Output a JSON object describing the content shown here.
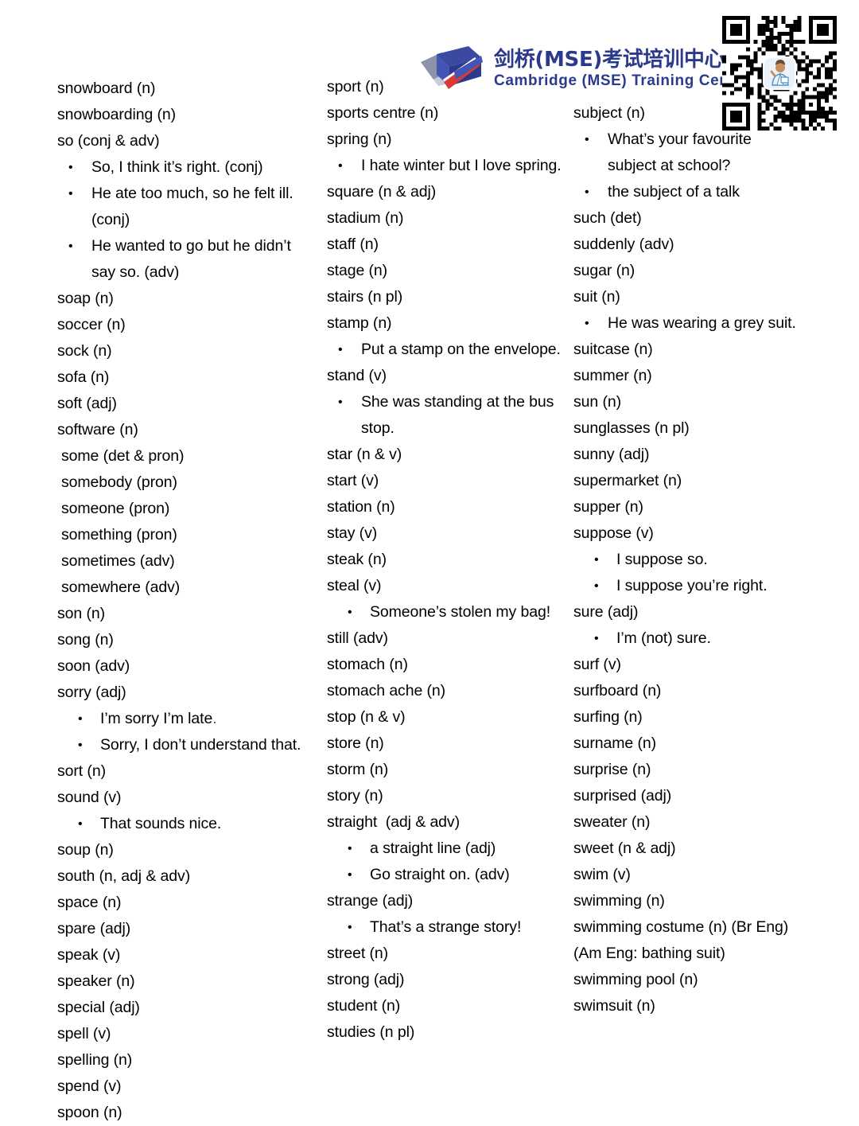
{
  "header": {
    "brand_cn": "剑桥(MSE)考试培训中心",
    "brand_en": "Cambridge (MSE) Training Centre",
    "brand_color": "#2b3a8c",
    "logo_icon": "open-book-logo-icon",
    "qr_icon": "qr-code-icon",
    "qr_avatar_icon": "teacher-avatar-icon"
  },
  "columns": [
    {
      "id": "column-1",
      "lines": [
        {
          "type": "entry",
          "text": "snowboard (n)"
        },
        {
          "type": "entry",
          "text": "snowboarding (n)"
        },
        {
          "type": "entry",
          "text": "so (conj & adv)"
        },
        {
          "type": "bullet",
          "text": "So, I think it’s right. (conj)"
        },
        {
          "type": "bullet",
          "text": "He ate too much, so he felt ill."
        },
        {
          "type": "cont",
          "text": "(conj)"
        },
        {
          "type": "bullet",
          "text": "He wanted to go but he didn’t"
        },
        {
          "type": "cont",
          "text": "say so. (adv)"
        },
        {
          "type": "entry",
          "text": "soap (n)"
        },
        {
          "type": "entry",
          "text": "soccer (n)"
        },
        {
          "type": "entry",
          "text": "sock (n)"
        },
        {
          "type": "entry",
          "text": "sofa (n)"
        },
        {
          "type": "entry",
          "text": "soft (adj)"
        },
        {
          "type": "entry",
          "text": "software (n)"
        },
        {
          "type": "entry",
          "indent": true,
          "text": "some (det & pron)"
        },
        {
          "type": "entry",
          "indent": true,
          "text": "somebody (pron)"
        },
        {
          "type": "entry",
          "indent": true,
          "text": "someone (pron)"
        },
        {
          "type": "entry",
          "indent": true,
          "text": "something (pron)"
        },
        {
          "type": "entry",
          "indent": true,
          "text": "sometimes (adv)"
        },
        {
          "type": "entry",
          "indent": true,
          "text": "somewhere (adv)"
        },
        {
          "type": "entry",
          "text": "son (n)"
        },
        {
          "type": "entry",
          "text": "song (n)"
        },
        {
          "type": "entry",
          "text": "soon (adv)"
        },
        {
          "type": "entry",
          "text": "sorry (adj)"
        },
        {
          "type": "bullet",
          "deep": true,
          "text": "I’m sorry I’m late",
          "suffix_red": "."
        },
        {
          "type": "bullet",
          "deep": true,
          "text": "Sorry, I don’t understand that."
        },
        {
          "type": "entry",
          "text": "sort (n)"
        },
        {
          "type": "entry",
          "text": "sound (v)"
        },
        {
          "type": "bullet",
          "deep": true,
          "text": "That sounds nice."
        },
        {
          "type": "entry",
          "text": "soup (n)"
        },
        {
          "type": "entry",
          "text": "south (n, adj & adv)"
        },
        {
          "type": "entry",
          "text": "space (n)"
        },
        {
          "type": "entry",
          "text": "spare (adj)"
        },
        {
          "type": "entry",
          "text": "speak (v)"
        },
        {
          "type": "entry",
          "text": "speaker (n)"
        },
        {
          "type": "entry",
          "text": "special (adj)"
        },
        {
          "type": "entry",
          "text": "spell (v)"
        },
        {
          "type": "entry",
          "text": "spelling (n)"
        },
        {
          "type": "entry",
          "text": "spend (v)"
        },
        {
          "type": "entry",
          "text": "spoon (n)"
        }
      ]
    },
    {
      "id": "column-2",
      "lines": [
        {
          "type": "entry",
          "text": "sport (n)"
        },
        {
          "type": "entry",
          "text": "sports centre (n)"
        },
        {
          "type": "entry",
          "text": "spring (n)"
        },
        {
          "type": "bullet",
          "text": "I hate winter but I love spring."
        },
        {
          "type": "entry",
          "text": "square (n & adj)"
        },
        {
          "type": "entry",
          "text": "stadium (n)"
        },
        {
          "type": "entry",
          "text": "staff (n)"
        },
        {
          "type": "entry",
          "text": "stage (n)"
        },
        {
          "type": "entry",
          "text": "stairs (n pl)"
        },
        {
          "type": "entry",
          "text": "stamp (n)"
        },
        {
          "type": "bullet",
          "text": "Put a stamp on the envelope."
        },
        {
          "type": "entry",
          "text": "stand (v)"
        },
        {
          "type": "bullet",
          "text": "She was standing at the bus"
        },
        {
          "type": "cont",
          "text": "stop."
        },
        {
          "type": "entry",
          "text": "star (n & v)"
        },
        {
          "type": "entry",
          "text": "start (v)"
        },
        {
          "type": "entry",
          "text": "station (n)"
        },
        {
          "type": "entry",
          "text": "stay (v)"
        },
        {
          "type": "entry",
          "text": "steak (n)"
        },
        {
          "type": "entry",
          "text": "steal (v)"
        },
        {
          "type": "bullet",
          "deep": true,
          "text": "Someone’s stolen my bag!"
        },
        {
          "type": "entry",
          "text": "still (adv)"
        },
        {
          "type": "entry",
          "text": "stomach (n)"
        },
        {
          "type": "entry",
          "text": "stomach ache (n)"
        },
        {
          "type": "entry",
          "text": "stop (n & v)"
        },
        {
          "type": "entry",
          "text": "store (n)"
        },
        {
          "type": "entry",
          "text": "storm (n)"
        },
        {
          "type": "entry",
          "text": "story (n)"
        },
        {
          "type": "entry",
          "text": "straight  (adj & adv)"
        },
        {
          "type": "bullet",
          "deep": true,
          "text": "a straight line (adj)"
        },
        {
          "type": "bullet",
          "deep": true,
          "text": "Go straight on. (adv)"
        },
        {
          "type": "entry",
          "text": "strange (adj)"
        },
        {
          "type": "bullet",
          "deep": true,
          "text": "That’s a strange story!"
        },
        {
          "type": "entry",
          "text": "street (n)"
        },
        {
          "type": "entry",
          "text": "strong (adj)"
        },
        {
          "type": "entry",
          "text": "student (n)"
        },
        {
          "type": "entry",
          "text": "studies (n pl)"
        }
      ]
    },
    {
      "id": "column-3",
      "lines": [
        {
          "type": "entry",
          "text": "subject (n)"
        },
        {
          "type": "bullet",
          "text": "What’s your favourite"
        },
        {
          "type": "cont",
          "text": "subject at school?"
        },
        {
          "type": "bullet",
          "text": "the subject of a talk"
        },
        {
          "type": "entry",
          "text": "such (det)"
        },
        {
          "type": "entry",
          "text": "suddenly (adv)"
        },
        {
          "type": "entry",
          "text": "sugar (n)"
        },
        {
          "type": "entry",
          "text": "suit (n)"
        },
        {
          "type": "bullet",
          "text": "He was wearing a grey suit."
        },
        {
          "type": "entry",
          "text": "suitcase (n)"
        },
        {
          "type": "entry",
          "text": "summer (n)"
        },
        {
          "type": "entry",
          "text": "sun (n)"
        },
        {
          "type": "entry",
          "text": "sunglasses (n pl)"
        },
        {
          "type": "entry",
          "text": "sunny (adj)"
        },
        {
          "type": "entry",
          "text": "supermarket (n)"
        },
        {
          "type": "entry",
          "text": "supper (n)"
        },
        {
          "type": "entry",
          "text": "suppose (v)"
        },
        {
          "type": "bullet",
          "deep": true,
          "text": "I suppose so."
        },
        {
          "type": "bullet",
          "deep": true,
          "text": "I suppose you’re right."
        },
        {
          "type": "entry",
          "text": "sure (adj)"
        },
        {
          "type": "bullet",
          "deep": true,
          "text": "I’m (not) sure."
        },
        {
          "type": "entry",
          "text": "surf (v)"
        },
        {
          "type": "entry",
          "text": "surfboard (n)"
        },
        {
          "type": "entry",
          "text": "surfing (n)"
        },
        {
          "type": "entry",
          "text": "surname (n)"
        },
        {
          "type": "entry",
          "text": "surprise (n)"
        },
        {
          "type": "entry",
          "text": "surprised (adj)"
        },
        {
          "type": "entry",
          "text": "sweater (n)"
        },
        {
          "type": "entry",
          "text": "sweet (n & adj)"
        },
        {
          "type": "entry",
          "text": "swim (v)"
        },
        {
          "type": "entry",
          "text": "swimming (n)"
        },
        {
          "type": "entry",
          "text": "swimming costume (n) (Br Eng)"
        },
        {
          "type": "entry",
          "text": "(Am Eng: bathing suit)"
        },
        {
          "type": "entry",
          "text": "swimming pool (n)"
        },
        {
          "type": "entry",
          "text": "swimsuit (n)"
        }
      ]
    }
  ],
  "layout": {
    "column_top_offsets": [
      95,
      93,
      126
    ],
    "line_height": 33
  }
}
